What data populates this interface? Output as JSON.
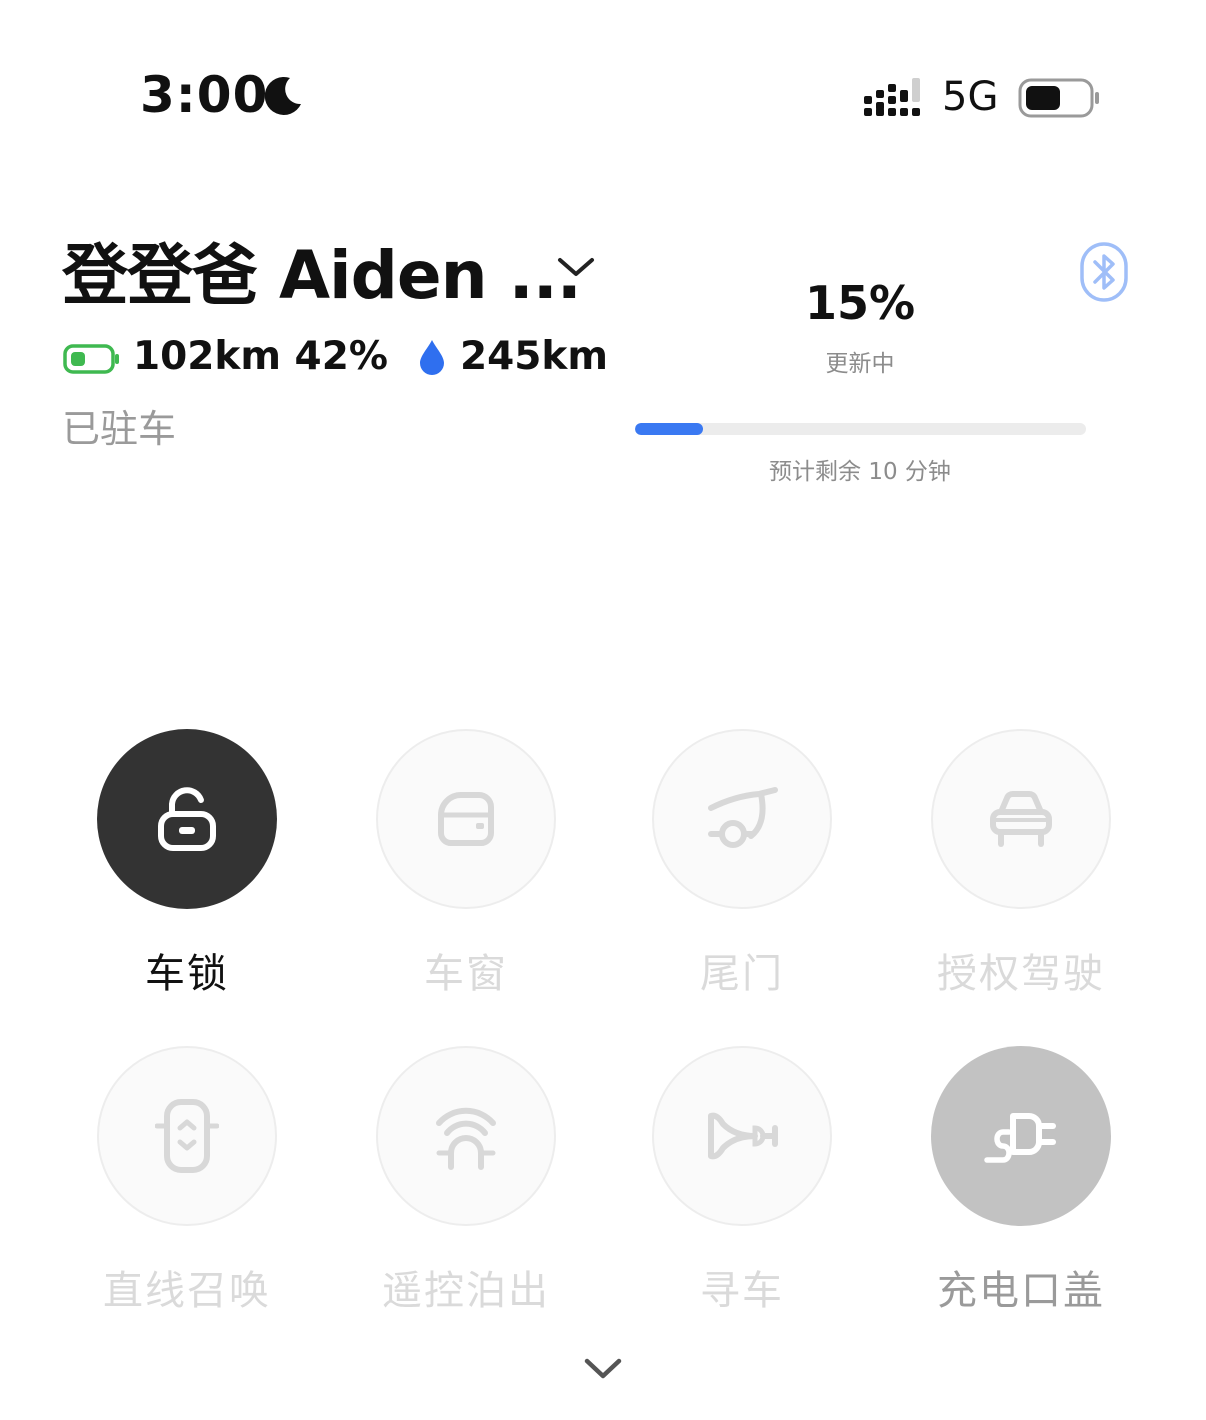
{
  "status_bar": {
    "time": "3:00",
    "network": "5G",
    "icons": [
      "moon-icon",
      "signal-icon",
      "battery-icon"
    ]
  },
  "vehicle": {
    "name": "登登爸 Aiden ...",
    "electric_range": "102km 42%",
    "fuel_range": "245km",
    "status": "已驻车"
  },
  "update": {
    "percent": "15%",
    "status": "更新中",
    "progress_fraction": 0.15,
    "remaining": "预计剩余 10 分钟"
  },
  "controls": [
    {
      "label": "车锁",
      "icon": "unlock-icon",
      "state": "active"
    },
    {
      "label": "车窗",
      "icon": "window-icon",
      "state": "disabled"
    },
    {
      "label": "尾门",
      "icon": "tailgate-icon",
      "state": "disabled"
    },
    {
      "label": "授权驾驶",
      "icon": "car-icon",
      "state": "disabled"
    },
    {
      "label": "直线召唤",
      "icon": "summon-icon",
      "state": "disabled"
    },
    {
      "label": "遥控泊出",
      "icon": "remote-park-icon",
      "state": "disabled"
    },
    {
      "label": "寻车",
      "icon": "horn-icon",
      "state": "disabled"
    },
    {
      "label": "充电口盖",
      "icon": "charge-port-icon",
      "state": "inactive"
    }
  ],
  "colors": {
    "accent_blue": "#3a79f2",
    "battery_green": "#3fb950",
    "active_button": "#333333",
    "inactive_button": "#c2c2c2"
  }
}
